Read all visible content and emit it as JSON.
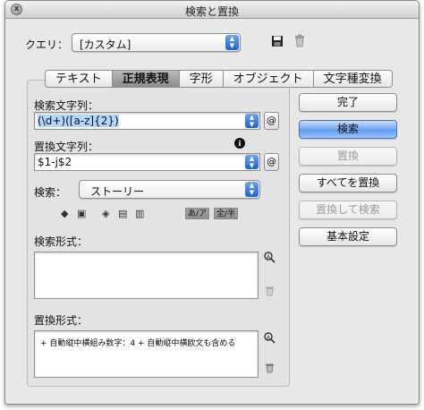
{
  "window": {
    "title": "検索と置換",
    "close_glyph": "x"
  },
  "query": {
    "label": "クエリ：",
    "value": "[カスタム]",
    "save_icon": "floppy-icon",
    "delete_icon": "trash-icon"
  },
  "tabs": [
    {
      "label": "テキスト",
      "active": false
    },
    {
      "label": "正規表現",
      "active": true
    },
    {
      "label": "字形",
      "active": false
    },
    {
      "label": "オブジェクト",
      "active": false
    },
    {
      "label": "文字種変換",
      "active": false
    }
  ],
  "find": {
    "label": "検索文字列：",
    "value": "(\\d+)([a-z]{2})",
    "special_char_button": "@"
  },
  "change": {
    "label": "置換文字列：",
    "value": "$1-j$2",
    "special_char_button": "@",
    "info_icon": "i"
  },
  "search": {
    "label": "検索：",
    "value": "ストーリー"
  },
  "width_options": {
    "halfwidth_kana": "あ/ア",
    "full_half": "全/半"
  },
  "find_format": {
    "label": "検索形式：",
    "text": ""
  },
  "change_format": {
    "label": "置換形式：",
    "text": "+ 自動縦中横組み数字：4 + 自動縦中横欧文も含める"
  },
  "buttons": {
    "done": "完了",
    "find": "検索",
    "change": "置換",
    "change_all": "すべてを置換",
    "change_find": "置換して検索",
    "basic_settings": "基本設定"
  },
  "colors": {
    "default_button": "#6fa4ee",
    "selection": "#b5d5ff",
    "stepper": "#2f6fd8"
  }
}
